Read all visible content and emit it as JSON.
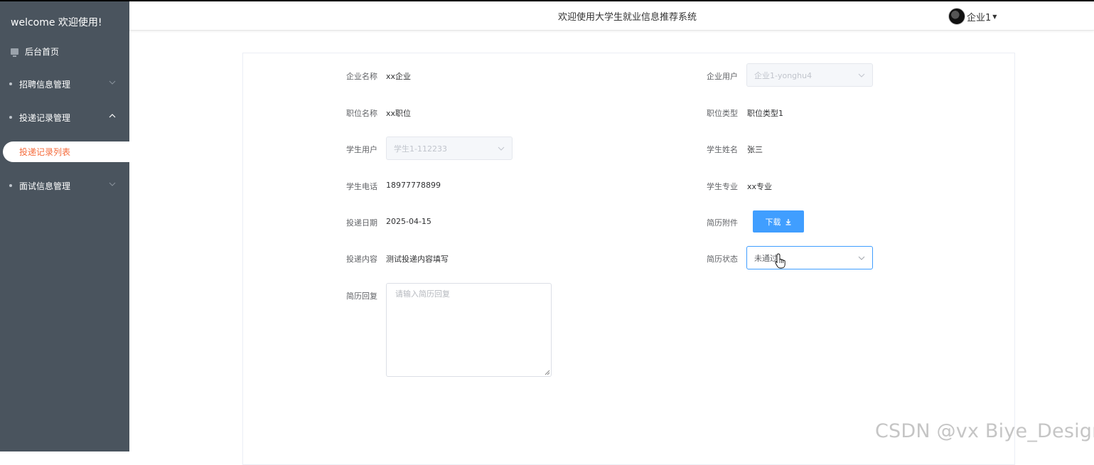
{
  "sidebar": {
    "welcome": "welcome 欢迎使用!",
    "home": "后台首页",
    "menus": [
      {
        "label": "招聘信息管理"
      },
      {
        "label": "投递记录管理"
      },
      {
        "label": "面试信息管理"
      }
    ],
    "active_sub": "投递记录列表"
  },
  "header": {
    "title": "欢迎使用大学生就业信息推荐系统",
    "user": "企业1"
  },
  "form": {
    "company_name_label": "企业名称",
    "company_name": "xx企业",
    "company_user_label": "企业用户",
    "company_user": "企业1-yonghu4",
    "job_name_label": "职位名称",
    "job_name": "xx职位",
    "job_type_label": "职位类型",
    "job_type": "职位类型1",
    "student_user_label": "学生用户",
    "student_user": "学生1-112233",
    "student_name_label": "学生姓名",
    "student_name": "张三",
    "student_phone_label": "学生电话",
    "student_phone": "18977778899",
    "student_major_label": "学生专业",
    "student_major": "xx专业",
    "delivery_date_label": "投递日期",
    "delivery_date": "2025-04-15",
    "resume_attachment_label": "简历附件",
    "download_label": "下载",
    "delivery_content_label": "投递内容",
    "delivery_content": "测试投递内容填写",
    "resume_status_label": "简历状态",
    "resume_status": "未通过",
    "resume_reply_label": "简历回复",
    "resume_reply_placeholder": "请输入简历回复"
  },
  "watermark": "CSDN @vx Biye_Design",
  "colors": {
    "sidebar_bg": "#4a545e",
    "active_text": "#f56c3c",
    "primary": "#409eff"
  }
}
